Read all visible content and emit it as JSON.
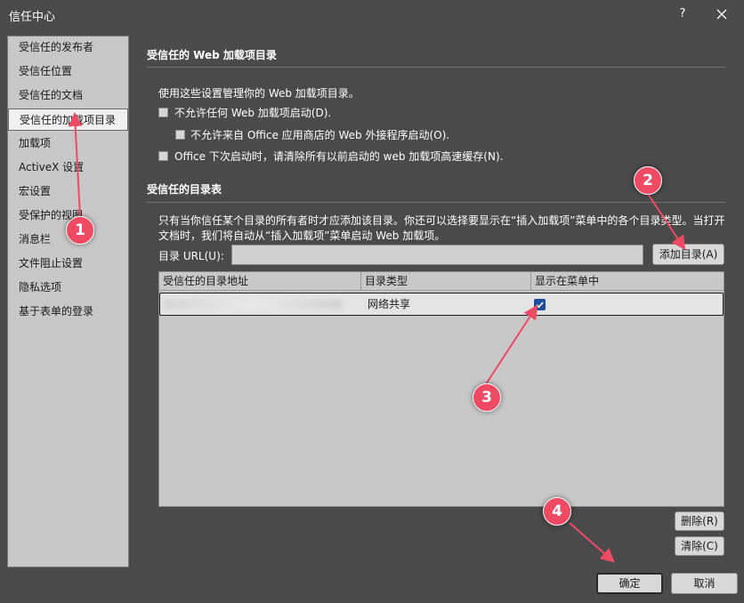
{
  "window": {
    "title": "信任中心",
    "help": "?"
  },
  "sidebar": {
    "items": [
      {
        "label": "受信任的发布者"
      },
      {
        "label": "受信任位置"
      },
      {
        "label": "受信任的文档"
      },
      {
        "label": "受信任的加载项目录",
        "selected": true
      },
      {
        "label": "加载项"
      },
      {
        "label": "ActiveX 设置"
      },
      {
        "label": "宏设置"
      },
      {
        "label": "受保护的视图"
      },
      {
        "label": "消息栏"
      },
      {
        "label": "文件阻止设置"
      },
      {
        "label": "隐私选项"
      },
      {
        "label": "基于表单的登录"
      }
    ]
  },
  "main": {
    "section1_title": "受信任的 Web 加载项目录",
    "section1_desc": "使用这些设置管理你的 Web 加载项目录。",
    "option_no_web_addins": "不允许任何 Web 加载项启动(D).",
    "option_no_store_addins": "不允许来自 Office 应用商店的 Web 外接程序启动(O).",
    "option_clear_cache": "Office 下次启动时，请清除所有以前启动的 web 加载项高速缓存(N).",
    "section2_title": "受信任的目录表",
    "section2_desc_line1": "只有当你信任某个目录的所有者时才应添加该目录。你还可以选择要显示在“插入加载项”菜单中的各个目录类型。当打开",
    "section2_desc_line2": "文档时，我们将自动从“插入加载项”菜单启动 Web 加载项。",
    "url_label": "目录 URL(U):",
    "url_value": "",
    "add_button": "添加目录(A)",
    "table": {
      "headers": [
        "受信任的目录地址",
        "目录类型",
        "显示在菜单中"
      ],
      "rows": [
        {
          "address": "",
          "type": "网络共享",
          "show_in_menu": true
        }
      ]
    },
    "delete_button": "删除(R)",
    "clear_button": "清除(C)"
  },
  "footer": {
    "ok": "确定",
    "cancel": "取消"
  },
  "annotations": {
    "color": "#ee4a63",
    "badges": [
      "1",
      "2",
      "3",
      "4"
    ]
  }
}
